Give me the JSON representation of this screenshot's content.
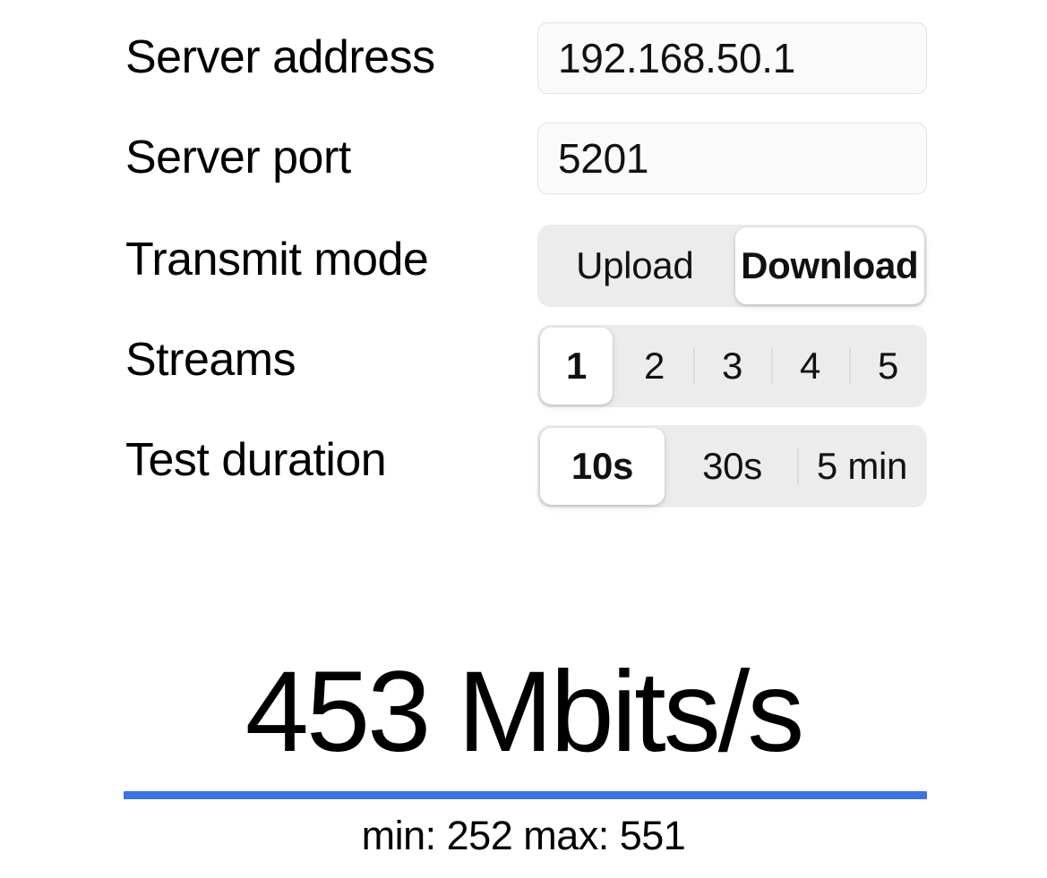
{
  "form": {
    "rows": [
      {
        "label": "Server address",
        "type": "input",
        "value": "192.168.50.1",
        "placeholder": "Server address",
        "name": "server-address"
      },
      {
        "label": "Server port",
        "type": "input",
        "value": "5201",
        "placeholder": "Server port",
        "name": "server-port"
      },
      {
        "label": "Transmit mode",
        "type": "segmented",
        "name": "transmit-mode",
        "selected": "Download",
        "options": [
          {
            "label": "Upload",
            "selected": false,
            "divider": false
          },
          {
            "label": "Download",
            "selected": true,
            "divider": false
          }
        ]
      },
      {
        "label": "Streams",
        "type": "segmented",
        "name": "streams",
        "selected": "1",
        "options": [
          {
            "label": "1",
            "selected": true,
            "divider": false
          },
          {
            "label": "2",
            "selected": false,
            "divider": false
          },
          {
            "label": "3",
            "selected": false,
            "divider": true
          },
          {
            "label": "4",
            "selected": false,
            "divider": true
          },
          {
            "label": "5",
            "selected": false,
            "divider": true
          }
        ]
      },
      {
        "label": "Test duration",
        "type": "segmented",
        "name": "test-duration",
        "selected": "10s",
        "options": [
          {
            "label": "10s",
            "selected": true,
            "divider": false
          },
          {
            "label": "30s",
            "selected": false,
            "divider": false
          },
          {
            "label": "5 min",
            "selected": false,
            "divider": true
          }
        ]
      }
    ]
  },
  "result": {
    "throughput": "453 Mbits/s",
    "value": "453",
    "unit": "Mbits/s",
    "min_max": "min: 252 max: 551",
    "min": "252",
    "max": "551",
    "bar_color": "#3d72e0"
  }
}
